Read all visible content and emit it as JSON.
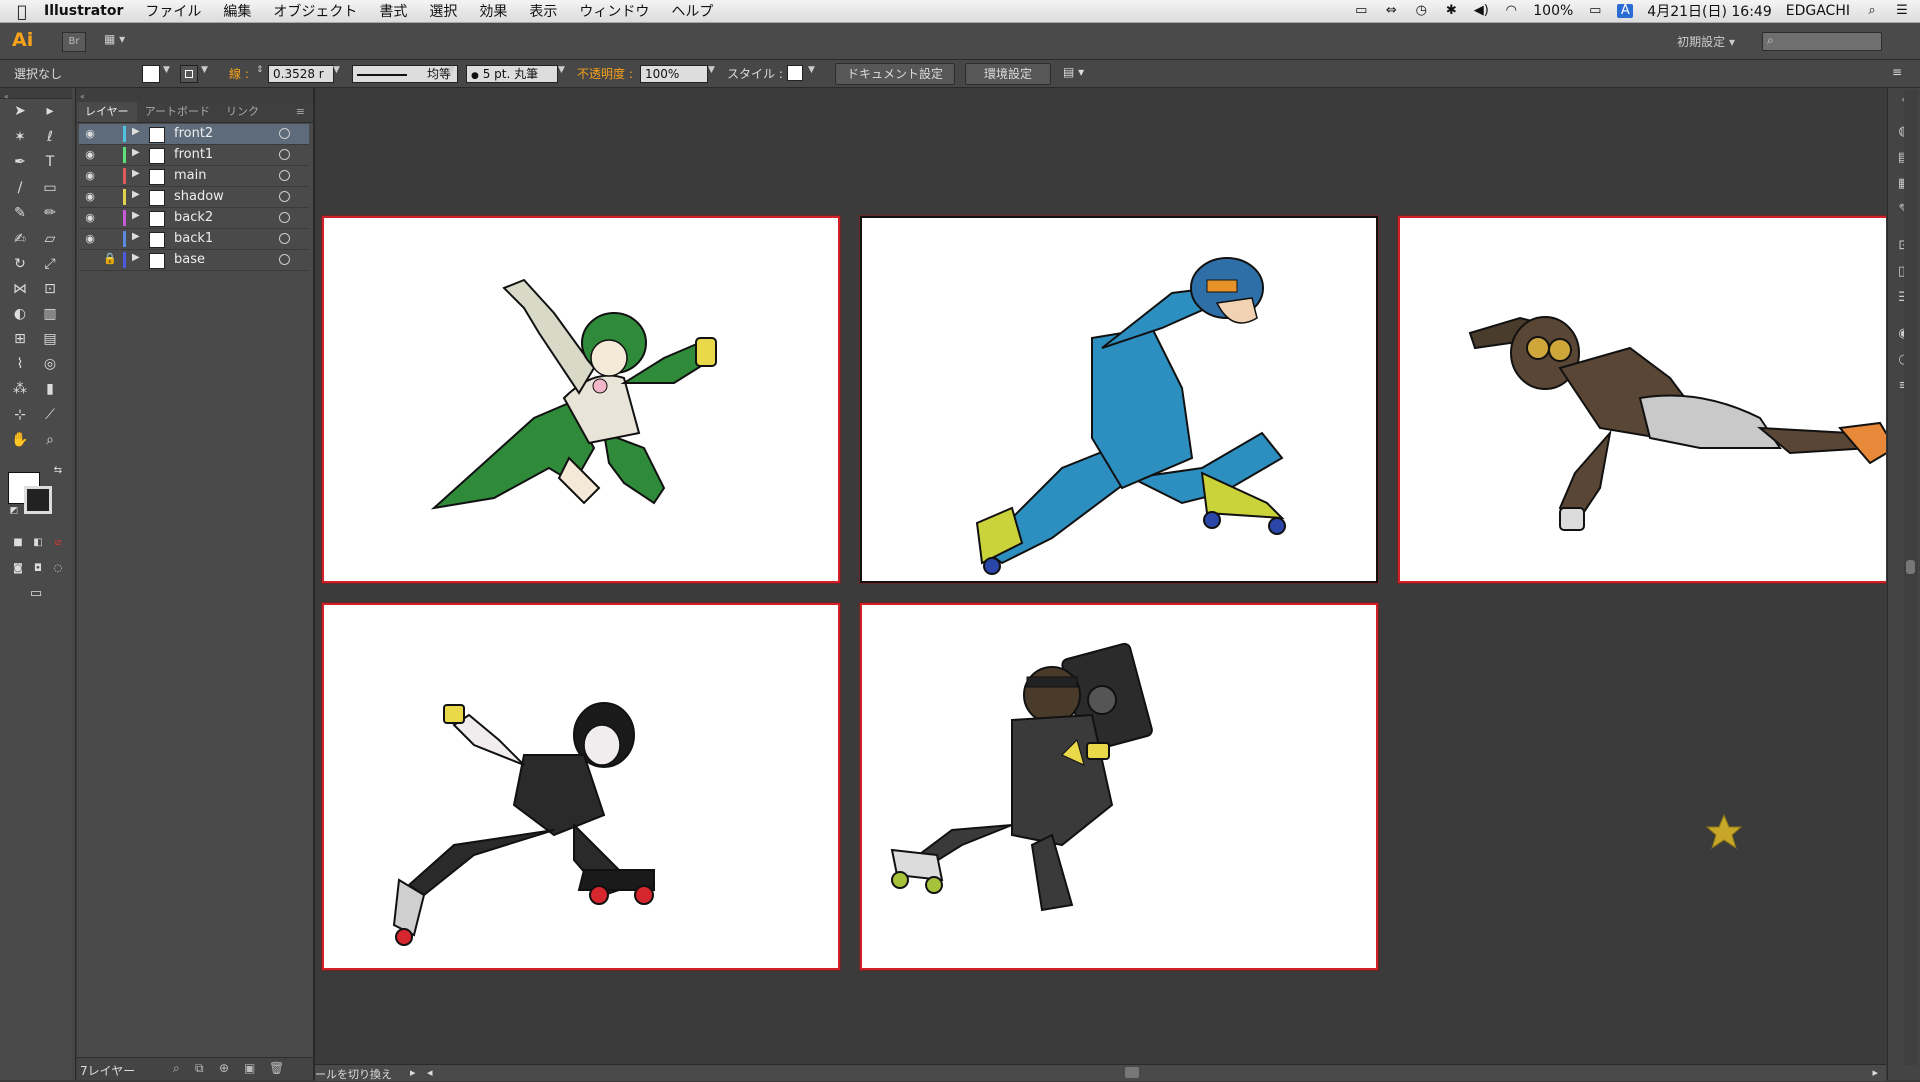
{
  "menubar": {
    "app_name": "Illustrator",
    "menus": [
      "ファイル",
      "編集",
      "オブジェクト",
      "書式",
      "選択",
      "効果",
      "表示",
      "ウィンドウ",
      "ヘルプ"
    ],
    "battery": "100%",
    "date_time": "4月21日(日)  16:49",
    "user": "EDGACHI"
  },
  "appbar": {
    "logo": "Ai",
    "bridge": "Br",
    "workspace": "初期設定"
  },
  "control": {
    "selection": "選択なし",
    "stroke_label": "線 :",
    "stroke_weight": "0.3528 r",
    "stroke_profile": "均等",
    "brush": "5 pt. 丸筆",
    "opacity_label": "不透明度 :",
    "opacity": "100%",
    "style_label": "スタイル :",
    "doc_setup": "ドキュメント設定",
    "prefs": "環境設定"
  },
  "layers_panel": {
    "tabs": [
      "レイヤー",
      "アートボード",
      "リンク"
    ],
    "layers": [
      {
        "name": "front2",
        "color": "#4ec3e0",
        "visible": true,
        "locked": false,
        "selected": true
      },
      {
        "name": "front1",
        "color": "#5de07a",
        "visible": true,
        "locked": false,
        "selected": false
      },
      {
        "name": "main",
        "color": "#e05a5a",
        "visible": true,
        "locked": false,
        "selected": false
      },
      {
        "name": "shadow",
        "color": "#e0d24e",
        "visible": true,
        "locked": false,
        "selected": false
      },
      {
        "name": "back2",
        "color": "#c75ad6",
        "visible": true,
        "locked": false,
        "selected": false
      },
      {
        "name": "back1",
        "color": "#5a8ae0",
        "visible": true,
        "locked": false,
        "selected": false
      },
      {
        "name": "base",
        "color": "#4a5ae0",
        "visible": false,
        "locked": true,
        "selected": false
      }
    ],
    "count": "7レイヤー"
  },
  "bottom": {
    "hint": "ールを切り換え"
  },
  "colors": {
    "accent": "#f7a21b",
    "artboard_border": "#d0202a"
  }
}
